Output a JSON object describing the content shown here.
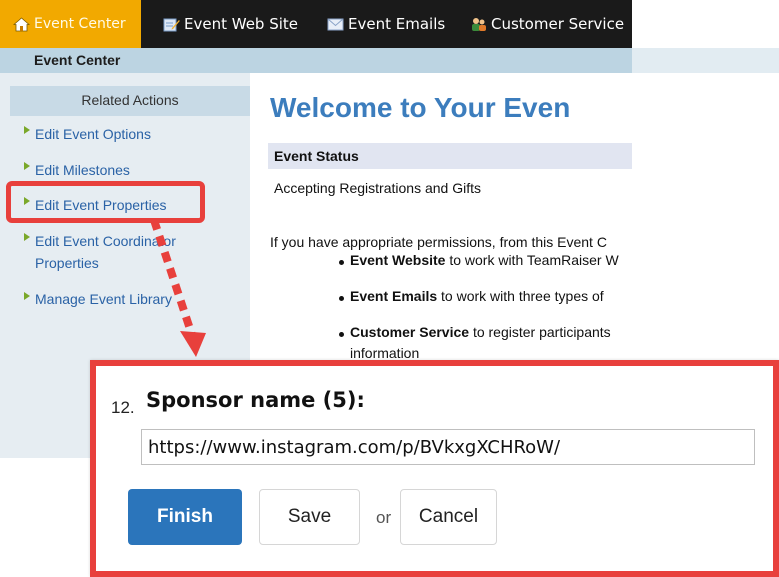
{
  "topnav": {
    "tabs": [
      {
        "label": "Event Center",
        "icon": "home-icon",
        "active": true
      },
      {
        "label": "Event Web Site",
        "icon": "edit-page-icon",
        "active": false
      },
      {
        "label": "Event Emails",
        "icon": "envelope-icon",
        "active": false
      },
      {
        "label": "Customer Service",
        "icon": "people-icon",
        "active": false
      }
    ]
  },
  "subbar": {
    "title": "Event Center"
  },
  "sidebar": {
    "heading": "Related Actions",
    "items": [
      {
        "label": "Edit Event Options"
      },
      {
        "label": "Edit Milestones"
      },
      {
        "label": "Edit Event Properties"
      },
      {
        "label_line1": "Edit Event Coordinator",
        "label_line2": "Properties"
      },
      {
        "label": "Manage Event Library"
      }
    ]
  },
  "main": {
    "welcome": "Welcome to Your Even",
    "status_heading": "Event Status",
    "status_value": "Accepting Registrations and Gifts",
    "intro": "If you have appropriate permissions, from this Event C",
    "bullets": [
      {
        "bold": "Event Website",
        "rest": " to work with TeamRaiser W"
      },
      {
        "bold": "Event Emails",
        "rest": " to work with three types of"
      },
      {
        "bold": "Customer Service",
        "rest": " to register participants",
        "rest2": "information"
      }
    ]
  },
  "zoom": {
    "question_number": "12.",
    "question_label": "Sponsor name (5):",
    "url_value": "https://www.instagram.com/p/BVkxgXCHRoW/",
    "finish_label": "Finish",
    "save_label": "Save",
    "or_label": "or",
    "cancel_label": "Cancel"
  },
  "colors": {
    "active_tab": "#f2a900",
    "link": "#2a62a6",
    "highlight": "#e8403c",
    "primary_button": "#2b75bb"
  }
}
